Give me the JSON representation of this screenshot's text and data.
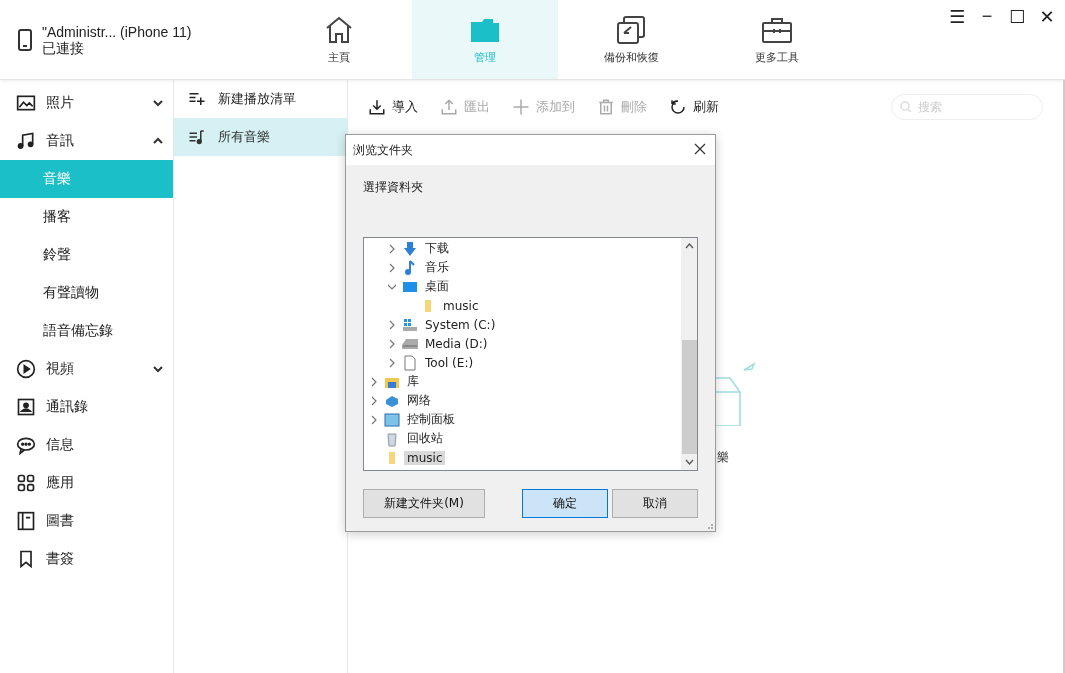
{
  "device": {
    "name": "\"Administr... (iPhone 11)",
    "status": "已連接"
  },
  "nav_tabs": [
    {
      "label": "主頁",
      "kind": "home",
      "selected": false
    },
    {
      "label": "管理",
      "kind": "folder",
      "selected": true
    },
    {
      "label": "備份和恢復",
      "kind": "backup",
      "selected": false
    },
    {
      "label": "更多工具",
      "kind": "toolbox",
      "selected": false
    }
  ],
  "window_controls": [
    "☰",
    "−",
    "☐",
    "✕"
  ],
  "sidebar": {
    "items": [
      {
        "label": "照片",
        "kind": "photo",
        "expanded": false,
        "selected": false
      },
      {
        "label": "音訊",
        "kind": "music",
        "expanded": true,
        "selected": false,
        "children": [
          {
            "label": "音樂",
            "selected": true
          },
          {
            "label": "播客",
            "selected": false
          },
          {
            "label": "鈴聲",
            "selected": false
          },
          {
            "label": "有聲讀物",
            "selected": false
          },
          {
            "label": "語音備忘錄",
            "selected": false
          }
        ]
      },
      {
        "label": "視頻",
        "kind": "video",
        "expanded": false,
        "selected": false
      },
      {
        "label": "通訊錄",
        "kind": "contacts",
        "selected": false
      },
      {
        "label": "信息",
        "kind": "message",
        "selected": false
      },
      {
        "label": "應用",
        "kind": "apps",
        "selected": false
      },
      {
        "label": "圖書",
        "kind": "book",
        "selected": false
      },
      {
        "label": "書簽",
        "kind": "bookmark",
        "selected": false
      }
    ]
  },
  "playlists": [
    {
      "label": "新建播放清單",
      "kind": "add",
      "selected": false
    },
    {
      "label": "所有音樂",
      "kind": "list",
      "selected": true
    }
  ],
  "toolbar": [
    {
      "label": "導入",
      "kind": "import",
      "disabled": false
    },
    {
      "label": "匯出",
      "kind": "export",
      "disabled": true
    },
    {
      "label": "添加到",
      "kind": "add",
      "disabled": true
    },
    {
      "label": "刪除",
      "kind": "delete",
      "disabled": true
    },
    {
      "label": "刷新",
      "kind": "refresh",
      "disabled": false
    }
  ],
  "search": {
    "placeholder": "搜索"
  },
  "empty_state": {
    "text": "樂"
  },
  "dialog": {
    "title": "浏览文件夹",
    "prompt": "選擇資料夾",
    "tree": {
      "scrolled_branch": [
        {
          "label": "下载",
          "kind": "download",
          "expanded": false,
          "selected": false
        },
        {
          "label": "音乐",
          "kind": "music",
          "expanded": false,
          "selected": false
        },
        {
          "label": "桌面",
          "kind": "desktop",
          "expanded": true,
          "selected": false,
          "children": [
            {
              "label": "music",
              "kind": "folder",
              "selected": false
            }
          ]
        },
        {
          "label": "System (C:)",
          "kind": "system-drive",
          "expanded": false,
          "selected": false
        },
        {
          "label": "Media (D:)",
          "kind": "drive",
          "expanded": false,
          "selected": false
        },
        {
          "label": "Tool (E:)",
          "kind": "file",
          "expanded": false,
          "selected": false
        }
      ],
      "items": [
        {
          "label": "库",
          "kind": "library",
          "expanded": false,
          "selected": false
        },
        {
          "label": "网络",
          "kind": "network",
          "expanded": false,
          "selected": false
        },
        {
          "label": "控制面板",
          "kind": "control-panel",
          "expanded": false,
          "selected": false
        },
        {
          "label": "回收站",
          "kind": "recycle",
          "selected": false
        },
        {
          "label": "music",
          "kind": "folder",
          "selected": true
        }
      ]
    },
    "buttons": [
      {
        "label": "新建文件夹(M)",
        "kind": "secondary"
      },
      {
        "label": "确定",
        "kind": "default"
      },
      {
        "label": "取消",
        "kind": "secondary"
      }
    ]
  }
}
